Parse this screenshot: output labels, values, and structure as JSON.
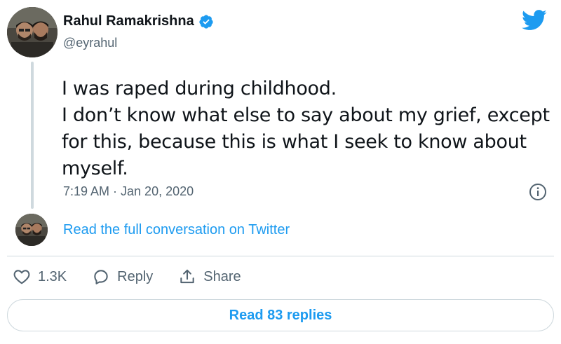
{
  "author": {
    "display_name": "Rahul Ramakrishna",
    "handle": "@eyrahul",
    "verified": true
  },
  "tweet": {
    "lines": [
      "I was raped during childhood.",
      "I don’t know what else to say about my grief, except\nfor this, because this is what I seek to know about\nmyself."
    ],
    "timestamp": "7:19 AM · Jan 20, 2020"
  },
  "conversation": {
    "link_text": "Read the full conversation on Twitter"
  },
  "actions": {
    "like_count": "1.3K",
    "reply_label": "Reply",
    "share_label": "Share"
  },
  "replies_button": {
    "label": "Read 83 replies"
  },
  "colors": {
    "accent": "#1d9bf0",
    "text": "#0f1419",
    "secondary": "#536471",
    "border": "#cfd9de"
  },
  "icons": {
    "logo": "twitter-bird-icon",
    "verified": "verified-badge-icon",
    "info": "info-icon",
    "like": "heart-icon",
    "reply": "speech-bubble-icon",
    "share": "share-upload-icon"
  }
}
